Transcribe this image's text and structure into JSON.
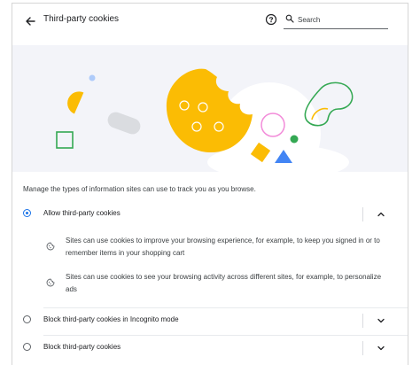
{
  "header": {
    "title": "Third-party cookies",
    "search_placeholder": "Search"
  },
  "description": "Manage the types of information sites can use to track you as you browse.",
  "options": [
    {
      "label": "Allow third-party cookies",
      "selected": true,
      "expanded": true,
      "details": [
        "Sites can use cookies to improve your browsing experience, for example, to keep you signed in or to remember items in your shopping cart",
        "Sites can use cookies to see your browsing activity across different sites, for example, to personalize ads"
      ]
    },
    {
      "label": "Block third-party cookies in Incognito mode",
      "selected": false,
      "expanded": false
    },
    {
      "label": "Block third-party cookies",
      "selected": false,
      "expanded": false
    }
  ],
  "colors": {
    "accent": "#1a73e8",
    "cookie_yellow": "#fbbc04",
    "green": "#34a853",
    "pink": "#f28bd9",
    "hero_bg": "#f3f4f9"
  }
}
